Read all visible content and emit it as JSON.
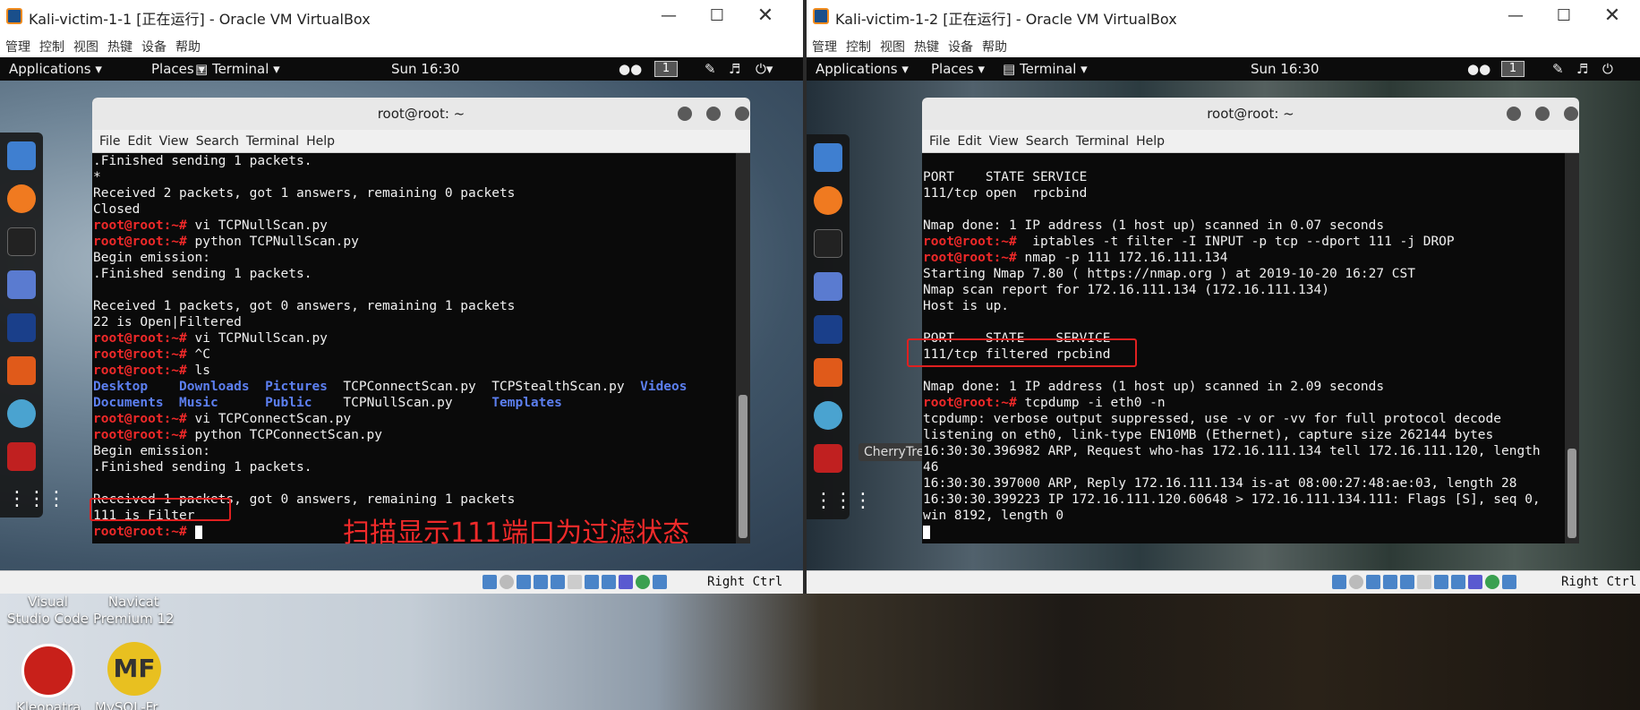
{
  "left_vm": {
    "window_title": "Kali-victim-1-1 [正在运行] - Oracle VM VirtualBox",
    "menu": [
      "管理",
      "控制",
      "视图",
      "热键",
      "设备",
      "帮助"
    ],
    "guest_topbar": {
      "applications": "Applications",
      "places": "Places",
      "terminal": "Terminal",
      "clock": "Sun 16:30",
      "workspace": "1"
    },
    "terminal": {
      "title": "root@root: ~",
      "menu": [
        "File",
        "Edit",
        "View",
        "Search",
        "Terminal",
        "Help"
      ],
      "lines": [
        {
          "text": ".Finished sending 1 packets."
        },
        {
          "text": "*"
        },
        {
          "text": "Received 2 packets, got 1 answers, remaining 0 packets"
        },
        {
          "text": "Closed"
        },
        {
          "prompt": "root@root:~# ",
          "text": "vi TCPNullScan.py"
        },
        {
          "prompt": "root@root:~# ",
          "text": "python TCPNullScan.py"
        },
        {
          "text": "Begin emission:"
        },
        {
          "text": ".Finished sending 1 packets."
        },
        {
          "text": ""
        },
        {
          "text": "Received 1 packets, got 0 answers, remaining 1 packets"
        },
        {
          "text": "22 is Open|Filtered"
        },
        {
          "prompt": "root@root:~# ",
          "text": "vi TCPNullScan.py"
        },
        {
          "prompt": "root@root:~# ",
          "text": "^C"
        },
        {
          "prompt": "root@root:~# ",
          "text": "ls"
        },
        {
          "ls": [
            "Desktop    ",
            "Downloads  ",
            "Pictures  "
          ],
          "rest": "TCPConnectScan.py  TCPStealthScan.py  ",
          "last": "Videos"
        },
        {
          "ls": [
            "Documents  ",
            "Music      ",
            "Public    "
          ],
          "rest": "TCPNullScan.py     ",
          "last": "Templates"
        },
        {
          "prompt": "root@root:~# ",
          "text": "vi TCPConnectScan.py"
        },
        {
          "prompt": "root@root:~# ",
          "text": "python TCPConnectScan.py"
        },
        {
          "text": "Begin emission:"
        },
        {
          "text": ".Finished sending 1 packets."
        },
        {
          "text": ""
        },
        {
          "text": "Received 1 packets, got 0 answers, remaining 1 packets"
        },
        {
          "text": "111 is Filter"
        },
        {
          "prompt": "root@root:~# ",
          "text": "",
          "cursor": true
        }
      ]
    },
    "annotation": "扫描显示111端口为过滤状态",
    "statusbar": {
      "host_key": "Right Ctrl"
    }
  },
  "right_vm": {
    "window_title": "Kali-victim-1-2 [正在运行] - Oracle VM VirtualBox",
    "menu": [
      "管理",
      "控制",
      "视图",
      "热键",
      "设备",
      "帮助"
    ],
    "guest_topbar": {
      "applications": "Applications",
      "places": "Places",
      "terminal": "Terminal",
      "clock": "Sun 16:30",
      "workspace": "1"
    },
    "terminal": {
      "title": "root@root: ~",
      "menu": [
        "File",
        "Edit",
        "View",
        "Search",
        "Terminal",
        "Help"
      ],
      "lines": [
        {
          "text": ""
        },
        {
          "text": "PORT    STATE SERVICE"
        },
        {
          "text": "111/tcp open  rpcbind"
        },
        {
          "text": ""
        },
        {
          "text": "Nmap done: 1 IP address (1 host up) scanned in 0.07 seconds"
        },
        {
          "prompt": "root@root:~# ",
          "text": " iptables -t filter -I INPUT -p tcp --dport 111 -j DROP"
        },
        {
          "prompt": "root@root:~# ",
          "text": "nmap -p 111 172.16.111.134"
        },
        {
          "text": "Starting Nmap 7.80 ( https://nmap.org ) at 2019-10-20 16:27 CST"
        },
        {
          "text": "Nmap scan report for 172.16.111.134 (172.16.111.134)"
        },
        {
          "text": "Host is up."
        },
        {
          "text": ""
        },
        {
          "text": "PORT    STATE    SERVICE"
        },
        {
          "text": "111/tcp filtered rpcbind"
        },
        {
          "text": ""
        },
        {
          "text": "Nmap done: 1 IP address (1 host up) scanned in 2.09 seconds"
        },
        {
          "prompt": "root@root:~# ",
          "text": "tcpdump -i eth0 -n"
        },
        {
          "text": "tcpdump: verbose output suppressed, use -v or -vv for full protocol decode"
        },
        {
          "text": "listening on eth0, link-type EN10MB (Ethernet), capture size 262144 bytes"
        },
        {
          "text": "16:30:30.396982 ARP, Request who-has 172.16.111.134 tell 172.16.111.120, length"
        },
        {
          "text": "46"
        },
        {
          "text": "16:30:30.397000 ARP, Reply 172.16.111.134 is-at 08:00:27:48:ae:03, length 28"
        },
        {
          "text": "16:30:30.399223 IP 172.16.111.120.60648 > 172.16.111.134.111: Flags [S], seq 0,"
        },
        {
          "text": "win 8192, length 0"
        },
        {
          "text": "",
          "cursor": true
        }
      ]
    },
    "tooltip": "CherryTree",
    "statusbar": {
      "host_key": "Right Ctrl"
    }
  },
  "desktop": {
    "icons": [
      {
        "label": "Visual\nStudio Code"
      },
      {
        "label": "Navicat\nPremium 12"
      },
      {
        "label": "Kleopatra"
      },
      {
        "label": "MySQL-Fr"
      }
    ],
    "mf_text": "MF"
  },
  "colors": {
    "prompt": "#ef2929",
    "dir": "#5c7ff0",
    "highlight": "#e02020",
    "terminal_bg": "#0a0a0a"
  }
}
